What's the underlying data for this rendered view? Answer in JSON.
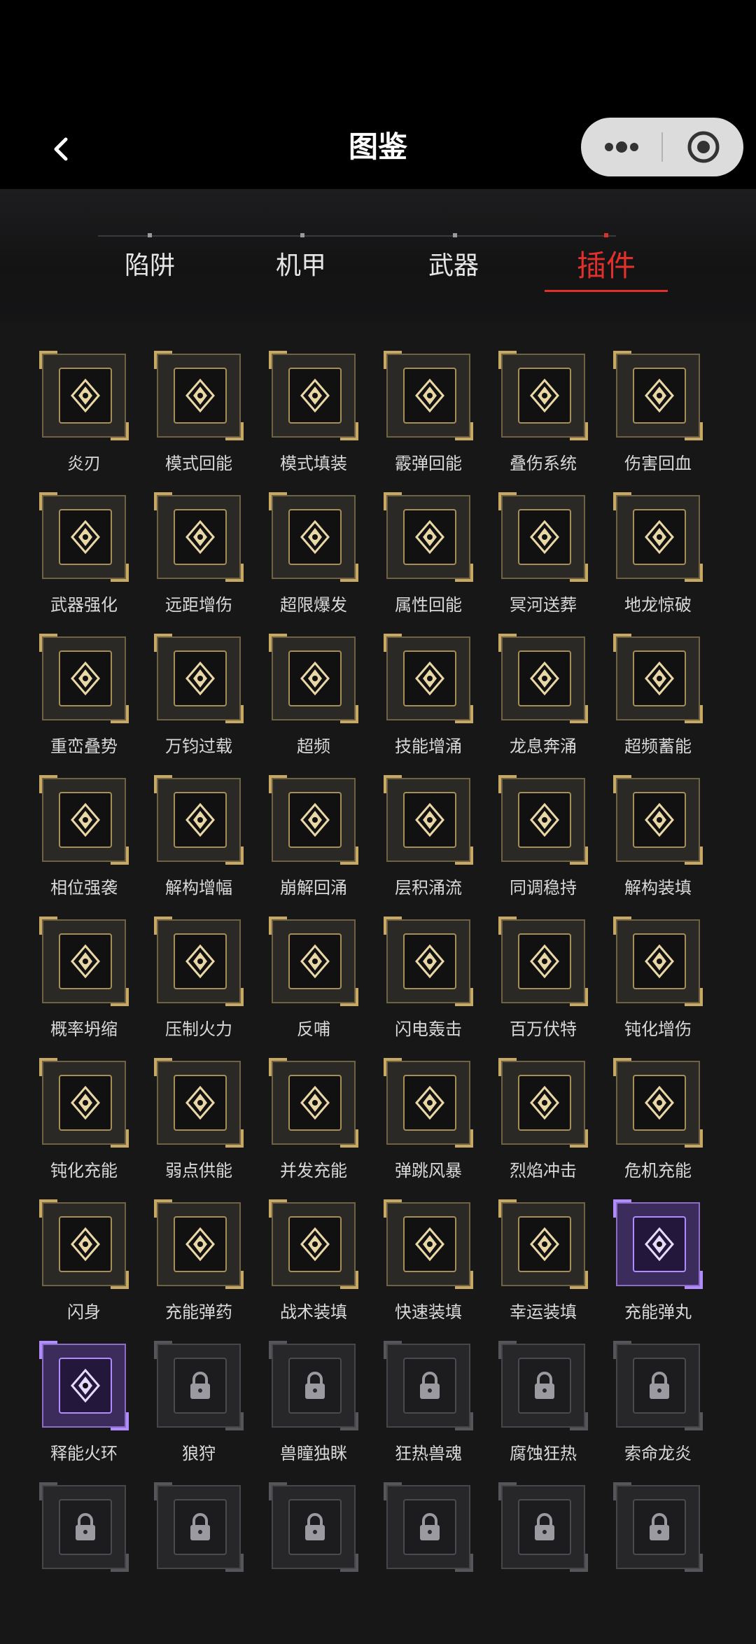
{
  "header": {
    "title": "图鉴",
    "back_icon": "chevron-left-icon",
    "menu_icon": "more-dots-icon",
    "close_icon": "record-target-icon"
  },
  "tabs": [
    {
      "label": "陷阱",
      "active": false
    },
    {
      "label": "机甲",
      "active": false
    },
    {
      "label": "武器",
      "active": false
    },
    {
      "label": "插件",
      "active": true
    }
  ],
  "colors": {
    "accent": "#e0302c",
    "gold": "#c7a964",
    "rare_purple": "#8c6cc7",
    "background": "#161617"
  },
  "plugins": [
    {
      "name": "炎刃",
      "state": "unlocked",
      "icon": "flame-blade-icon"
    },
    {
      "name": "模式回能",
      "state": "unlocked",
      "icon": "mode-recharge-icon"
    },
    {
      "name": "模式填装",
      "state": "unlocked",
      "icon": "mode-reload-icon"
    },
    {
      "name": "霰弹回能",
      "state": "unlocked",
      "icon": "shotgun-recharge-icon"
    },
    {
      "name": "叠伤系统",
      "state": "unlocked",
      "icon": "stack-damage-icon"
    },
    {
      "name": "伤害回血",
      "state": "unlocked",
      "icon": "damage-heal-icon"
    },
    {
      "name": "武器强化",
      "state": "unlocked",
      "icon": "weapon-boost-icon"
    },
    {
      "name": "远距增伤",
      "state": "unlocked",
      "icon": "long-range-icon"
    },
    {
      "name": "超限爆发",
      "state": "unlocked",
      "icon": "overlimit-burst-icon"
    },
    {
      "name": "属性回能",
      "state": "unlocked",
      "icon": "attribute-recharge-icon"
    },
    {
      "name": "冥河送葬",
      "state": "unlocked",
      "icon": "styx-funeral-icon"
    },
    {
      "name": "地龙惊破",
      "state": "unlocked",
      "icon": "earth-dragon-icon"
    },
    {
      "name": "重峦叠势",
      "state": "unlocked",
      "icon": "mountain-stack-icon"
    },
    {
      "name": "万钧过载",
      "state": "unlocked",
      "icon": "overload-icon"
    },
    {
      "name": "超频",
      "state": "unlocked",
      "icon": "overclock-icon"
    },
    {
      "name": "技能增涌",
      "state": "unlocked",
      "icon": "skill-surge-icon"
    },
    {
      "name": "龙息奔涌",
      "state": "unlocked",
      "icon": "dragon-breath-icon"
    },
    {
      "name": "超频蓄能",
      "state": "unlocked",
      "icon": "overclock-charge-icon"
    },
    {
      "name": "相位强袭",
      "state": "unlocked",
      "icon": "phase-assault-icon"
    },
    {
      "name": "解构增幅",
      "state": "unlocked",
      "icon": "deconstruct-amp-icon"
    },
    {
      "name": "崩解回涌",
      "state": "unlocked",
      "icon": "collapse-surge-icon"
    },
    {
      "name": "层积涌流",
      "state": "unlocked",
      "icon": "layer-flow-icon"
    },
    {
      "name": "同调稳持",
      "state": "unlocked",
      "icon": "sync-stable-icon"
    },
    {
      "name": "解构装填",
      "state": "unlocked",
      "icon": "deconstruct-reload-icon"
    },
    {
      "name": "概率坍缩",
      "state": "unlocked",
      "icon": "probability-collapse-icon"
    },
    {
      "name": "压制火力",
      "state": "unlocked",
      "icon": "suppress-fire-icon"
    },
    {
      "name": "反哺",
      "state": "unlocked",
      "icon": "feedback-icon"
    },
    {
      "name": "闪电轰击",
      "state": "unlocked",
      "icon": "lightning-strike-icon"
    },
    {
      "name": "百万伏特",
      "state": "unlocked",
      "icon": "million-volt-icon"
    },
    {
      "name": "钝化增伤",
      "state": "unlocked",
      "icon": "blunt-damage-icon"
    },
    {
      "name": "钝化充能",
      "state": "unlocked",
      "icon": "blunt-charge-icon"
    },
    {
      "name": "弱点供能",
      "state": "unlocked",
      "icon": "weakpoint-energy-icon"
    },
    {
      "name": "并发充能",
      "state": "unlocked",
      "icon": "concurrent-charge-icon"
    },
    {
      "name": "弹跳风暴",
      "state": "unlocked",
      "icon": "bounce-storm-icon"
    },
    {
      "name": "烈焰冲击",
      "state": "unlocked",
      "icon": "flame-impact-icon"
    },
    {
      "name": "危机充能",
      "state": "unlocked",
      "icon": "crisis-charge-icon"
    },
    {
      "name": "闪身",
      "state": "unlocked",
      "icon": "dash-icon"
    },
    {
      "name": "充能弹药",
      "state": "unlocked",
      "icon": "charged-ammo-icon"
    },
    {
      "name": "战术装填",
      "state": "unlocked",
      "icon": "tactical-reload-icon"
    },
    {
      "name": "快速装填",
      "state": "unlocked",
      "icon": "quick-reload-icon"
    },
    {
      "name": "幸运装填",
      "state": "unlocked",
      "icon": "lucky-reload-icon"
    },
    {
      "name": "充能弹丸",
      "state": "rare",
      "icon": "charged-pellet-icon"
    },
    {
      "name": "释能火环",
      "state": "rare",
      "icon": "energy-fire-ring-icon"
    },
    {
      "name": "狼狩",
      "state": "locked",
      "icon": "lock-icon"
    },
    {
      "name": "兽瞳独眯",
      "state": "locked",
      "icon": "lock-icon"
    },
    {
      "name": "狂热兽魂",
      "state": "locked",
      "icon": "lock-icon"
    },
    {
      "name": "腐蚀狂热",
      "state": "locked",
      "icon": "lock-icon"
    },
    {
      "name": "索命龙炎",
      "state": "locked",
      "icon": "lock-icon"
    },
    {
      "name": "",
      "state": "locked",
      "icon": "lock-icon"
    },
    {
      "name": "",
      "state": "locked",
      "icon": "lock-icon"
    },
    {
      "name": "",
      "state": "locked",
      "icon": "lock-icon"
    },
    {
      "name": "",
      "state": "locked",
      "icon": "lock-icon"
    },
    {
      "name": "",
      "state": "locked",
      "icon": "lock-icon"
    },
    {
      "name": "",
      "state": "locked",
      "icon": "lock-icon"
    }
  ]
}
